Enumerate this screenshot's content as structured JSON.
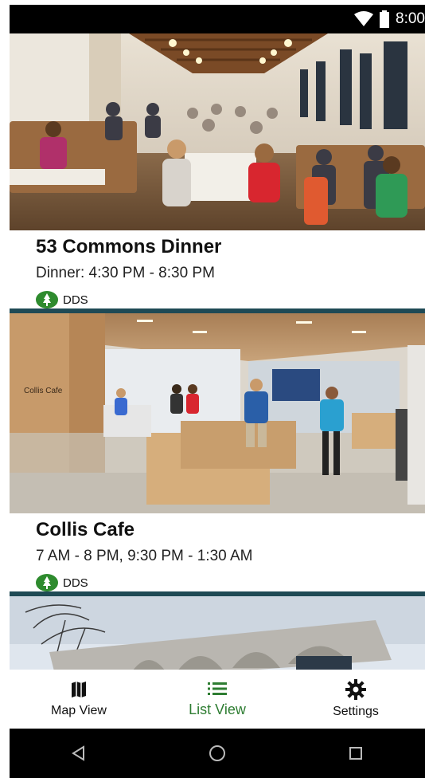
{
  "status_bar": {
    "time": "8:00",
    "icons": [
      "wifi-icon",
      "battery-icon"
    ]
  },
  "locations": [
    {
      "title": "53 Commons Dinner",
      "hours": "Dinner: 4:30 PM - 8:30 PM",
      "badge": "DDS"
    },
    {
      "title": "Collis Cafe",
      "hours": "7 AM - 8 PM, 9:30 PM - 1:30 AM",
      "badge": "DDS"
    }
  ],
  "bottom_nav": {
    "items": [
      {
        "label": "Map View",
        "icon": "map-icon",
        "active": false
      },
      {
        "label": "List View",
        "icon": "list-icon",
        "active": true
      },
      {
        "label": "Settings",
        "icon": "gear-icon",
        "active": false
      }
    ]
  },
  "system_nav": {
    "icons": [
      "back-icon",
      "home-icon",
      "recents-icon"
    ]
  },
  "colors": {
    "accent": "#2e7d32",
    "divider": "#1f4a55",
    "badge_green": "#2e8b2e"
  }
}
